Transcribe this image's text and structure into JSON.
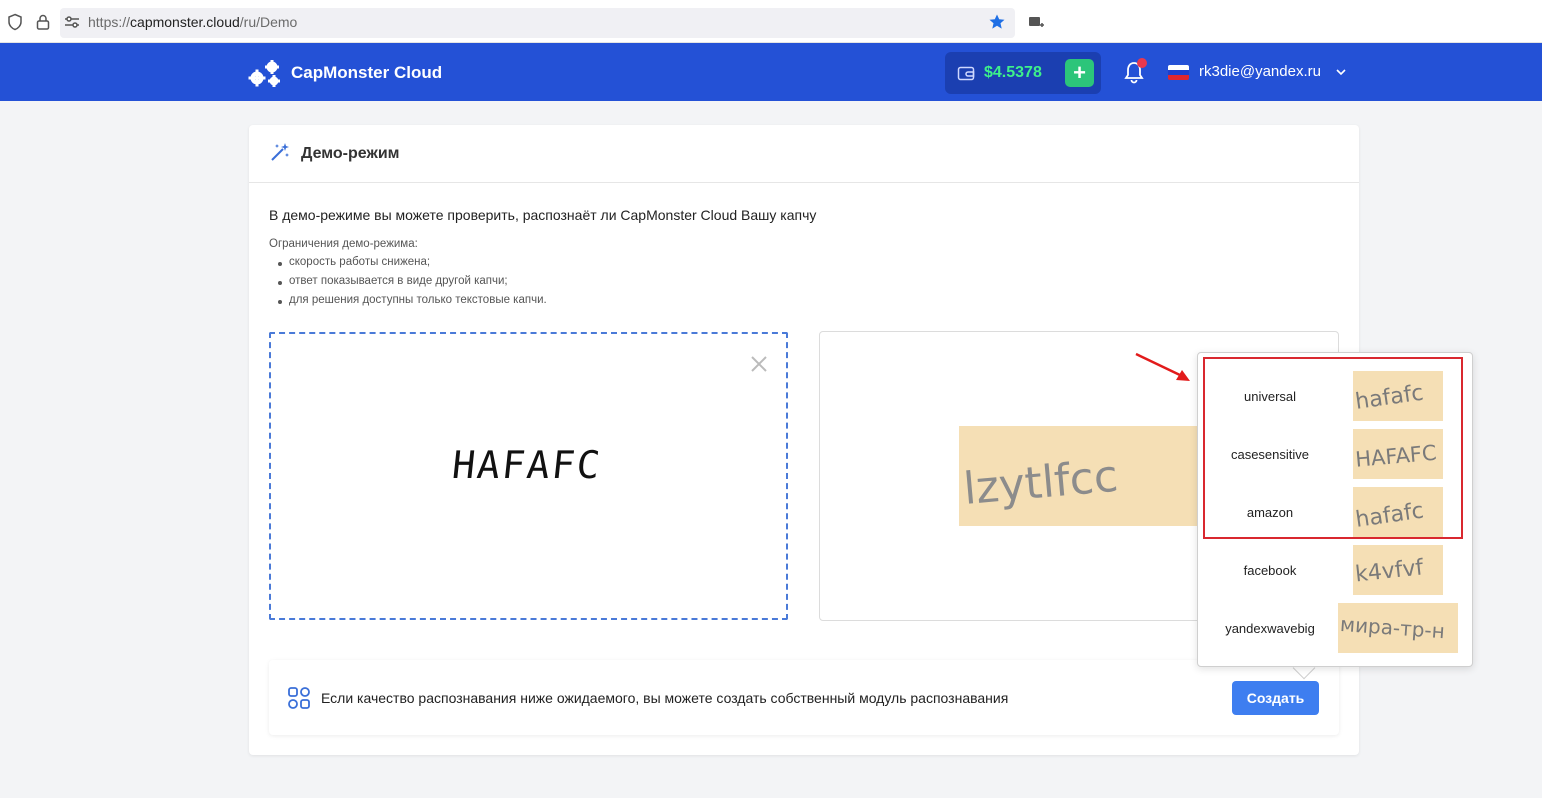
{
  "browser": {
    "url_prefix": "https://",
    "url_host": "capmonster.cloud",
    "url_path": "/ru/Demo"
  },
  "header": {
    "app_name": "CapMonster Cloud",
    "balance": "$4.5378",
    "add_funds_label": "+",
    "user_email": "rk3die@yandex.ru",
    "brand_color": "#2451d6",
    "balance_color": "#3ef08a"
  },
  "card": {
    "title": "Демо-режим",
    "intro": "В демо-режиме вы можете проверить, распознаёт ли CapMonster Cloud Вашу капчу",
    "limits_title": "Ограничения демо-режима:",
    "limits": [
      "скорость работы снижена;",
      "ответ показывается в виде другой капчи;",
      "для решения доступны только текстовые капчи."
    ],
    "input_captcha_text": "HAFAFC",
    "result_captcha_text": "lzytlfcc"
  },
  "create_panel": {
    "text": "Если качество распознавания ниже ожидаемого, вы можете создать собственный модуль распознавания",
    "button_label": "Создать"
  },
  "modules": [
    {
      "name": "universal",
      "sample": "hafafc"
    },
    {
      "name": "casesensitive",
      "sample": "HAFAFC"
    },
    {
      "name": "amazon",
      "sample": "hafafc"
    },
    {
      "name": "facebook",
      "sample": "k4vfvf"
    },
    {
      "name": "yandexwavebig",
      "sample": "мира-тр-н"
    }
  ]
}
